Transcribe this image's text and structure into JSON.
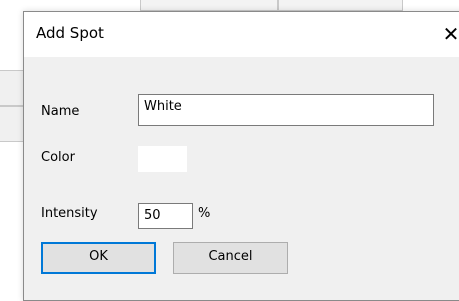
{
  "dialog": {
    "title": "Add Spot",
    "close_glyph": "✕"
  },
  "form": {
    "name_label": "Name",
    "name_value": "White",
    "color_label": "Color",
    "color_value": "#ffffff",
    "intensity_label": "Intensity",
    "intensity_value": "50",
    "intensity_unit": "%"
  },
  "buttons": {
    "ok": "OK",
    "cancel": "Cancel"
  }
}
